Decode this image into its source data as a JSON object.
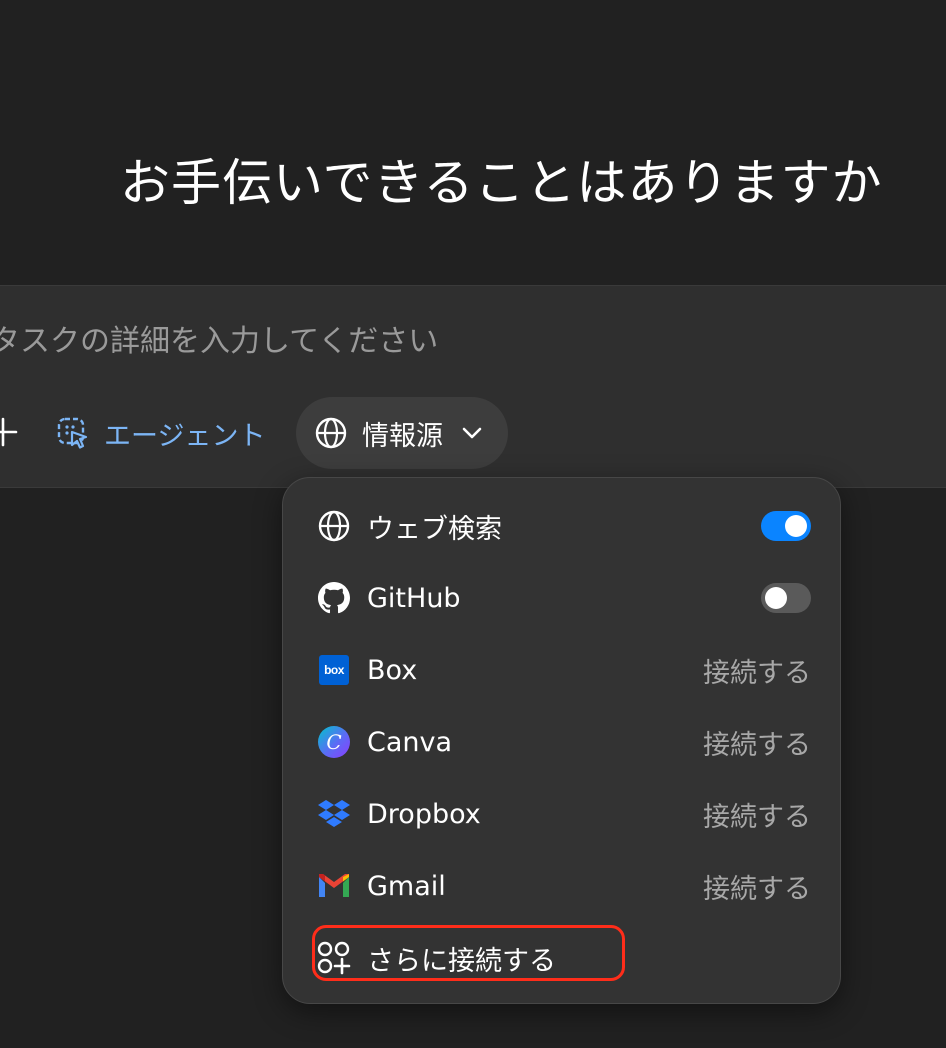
{
  "heading": "お手伝いできることはありますか",
  "composer": {
    "placeholder": "タスクの詳細を入力してください",
    "agent_label": "エージェント",
    "sources_label": "情報源"
  },
  "sources_menu": {
    "items": [
      {
        "label": "ウェブ検索",
        "icon": "globe-icon",
        "toggle": "on"
      },
      {
        "label": "GitHub",
        "icon": "github-icon",
        "toggle": "off"
      },
      {
        "label": "Box",
        "icon": "box-logo-icon",
        "action": "接続する"
      },
      {
        "label": "Canva",
        "icon": "canva-logo-icon",
        "action": "接続する"
      },
      {
        "label": "Dropbox",
        "icon": "dropbox-logo-icon",
        "action": "接続する"
      },
      {
        "label": "Gmail",
        "icon": "gmail-logo-icon",
        "action": "接続する"
      }
    ],
    "more_label": "さらに接続する",
    "box_logo_text": "box",
    "canva_logo_text": "C"
  },
  "colors": {
    "background": "#212121",
    "composer": "#2f2f2f",
    "menu": "#333333",
    "accent_blue": "#0a84ff",
    "agent_blue": "#7cb5f5",
    "highlight_red": "#ff2d1a"
  }
}
